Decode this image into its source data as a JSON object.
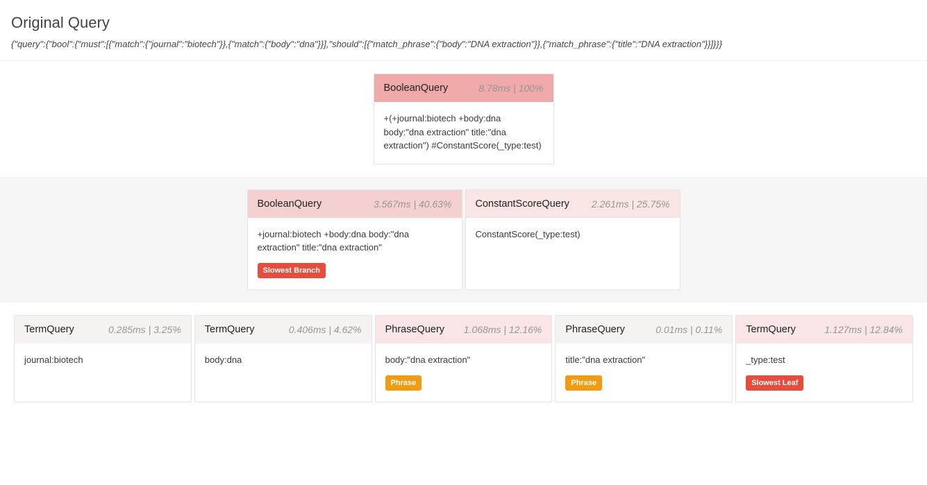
{
  "header": {
    "title": "Original Query",
    "json": "{\"query\":{\"bool\":{\"must\":[{\"match\":{\"journal\":\"biotech\"}},{\"match\":{\"body\":\"dna\"}}],\"should\":[{\"match_phrase\":{\"body\":\"DNA extraction\"}},{\"match_phrase\":{\"title\":\"DNA extraction\"}}]}}}"
  },
  "root": {
    "title": "BooleanQuery",
    "stats": "8.78ms | 100%",
    "body": "+(+journal:biotech +body:dna body:\"dna extraction\" title:\"dna extraction\") #ConstantScore(_type:test)"
  },
  "mid": [
    {
      "title": "BooleanQuery",
      "stats": "3.567ms | 40.63%",
      "body": "+journal:biotech +body:dna body:\"dna extraction\" title:\"dna extraction\"",
      "badge": {
        "text": "Slowest Branch",
        "cls": "badge-red"
      },
      "hdr": "hdr-mid"
    },
    {
      "title": "ConstantScoreQuery",
      "stats": "2.261ms | 25.75%",
      "body": "ConstantScore(_type:test)",
      "hdr": "hdr-light"
    }
  ],
  "leaves": [
    {
      "title": "TermQuery",
      "stats": "0.285ms | 3.25%",
      "body": "journal:biotech",
      "hdr": "hdr-faint"
    },
    {
      "title": "TermQuery",
      "stats": "0.406ms | 4.62%",
      "body": "body:dna",
      "hdr": "hdr-faint"
    },
    {
      "title": "PhraseQuery",
      "stats": "1.068ms | 12.16%",
      "body": "body:\"dna extraction\"",
      "badge": {
        "text": "Phrase",
        "cls": "badge-orange"
      },
      "hdr": "hdr-light"
    },
    {
      "title": "PhraseQuery",
      "stats": "0.01ms | 0.11%",
      "body": "title:\"dna extraction\"",
      "badge": {
        "text": "Phrase",
        "cls": "badge-orange"
      },
      "hdr": "hdr-faint"
    },
    {
      "title": "TermQuery",
      "stats": "1.127ms | 12.84%",
      "body": "_type:test",
      "badge": {
        "text": "Slowest Leaf",
        "cls": "badge-red"
      },
      "hdr": "hdr-light"
    }
  ]
}
